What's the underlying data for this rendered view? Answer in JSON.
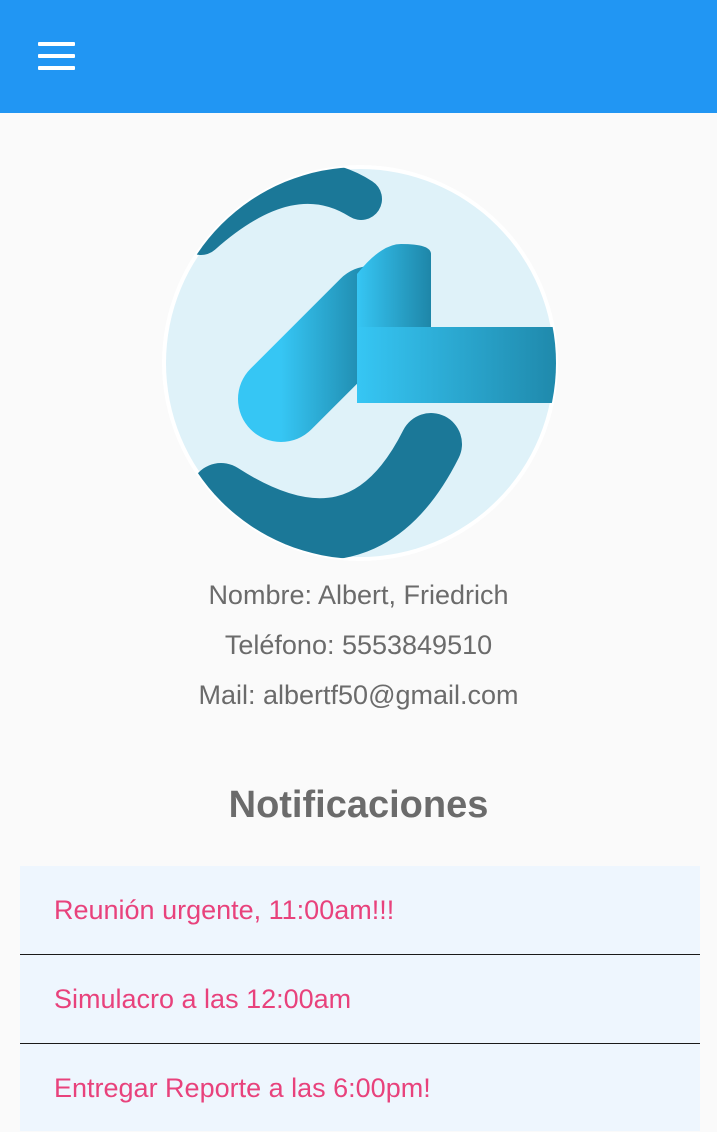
{
  "header": {
    "menu_icon": "hamburger-menu-icon",
    "background_color": "#2196f3"
  },
  "profile": {
    "avatar_icon": "logo-avatar",
    "name": "Nombre: Albert, Friedrich",
    "phone": "Teléfono: 5553849510",
    "mail": "Mail: albertf50@gmail.com"
  },
  "notifications": {
    "title": "Notificaciones",
    "text_color": "#e8427c",
    "items": [
      {
        "label": "Reunión urgente, 11:00am!!!"
      },
      {
        "label": "Simulacro a las 12:00am"
      },
      {
        "label": "Entregar Reporte a las 6:00pm!"
      }
    ]
  }
}
